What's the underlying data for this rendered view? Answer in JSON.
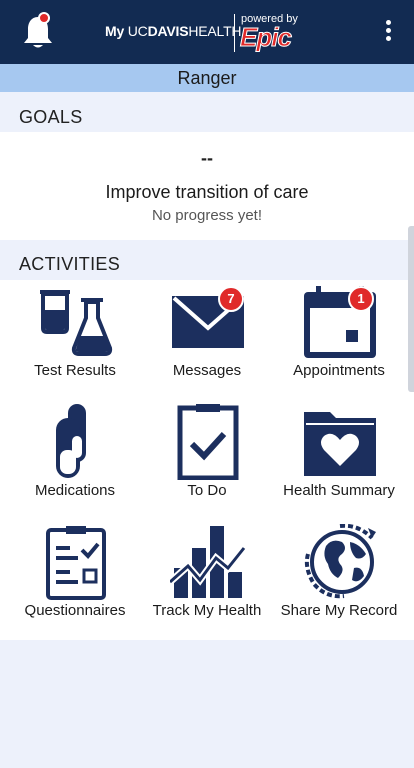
{
  "header": {
    "brand_my": "My",
    "brand_uc": "UC",
    "brand_davis": "DAVIS",
    "brand_health": "HEALTH",
    "powered_by": "powered by",
    "epic": "Epic",
    "notification_icon": "bell-icon",
    "menu_icon": "kebab-menu-icon"
  },
  "patient": {
    "name": "Ranger"
  },
  "goals": {
    "heading": "GOALS",
    "dash": "--",
    "title": "Improve transition of care",
    "progress": "No progress yet!"
  },
  "activities": {
    "heading": "ACTIVITIES",
    "items": [
      {
        "label": "Test Results",
        "icon": "lab-flask-icon"
      },
      {
        "label": "Messages",
        "icon": "envelope-icon",
        "badge": "7"
      },
      {
        "label": "Appointments",
        "icon": "calendar-icon",
        "badge": "1"
      },
      {
        "label": "Medications",
        "icon": "pills-icon"
      },
      {
        "label": "To Do",
        "icon": "clipboard-check-icon"
      },
      {
        "label": "Health Summary",
        "icon": "folder-heart-icon"
      },
      {
        "label": "Questionnaires",
        "icon": "checklist-icon"
      },
      {
        "label": "Track My Health",
        "icon": "trend-chart-icon"
      },
      {
        "label": "Share My Record",
        "icon": "globe-share-icon"
      }
    ]
  },
  "colors": {
    "header": "#122b52",
    "accent_red": "#e02a2a",
    "patient_bar": "#a6c8f0",
    "icon_navy": "#1c2f5e"
  }
}
